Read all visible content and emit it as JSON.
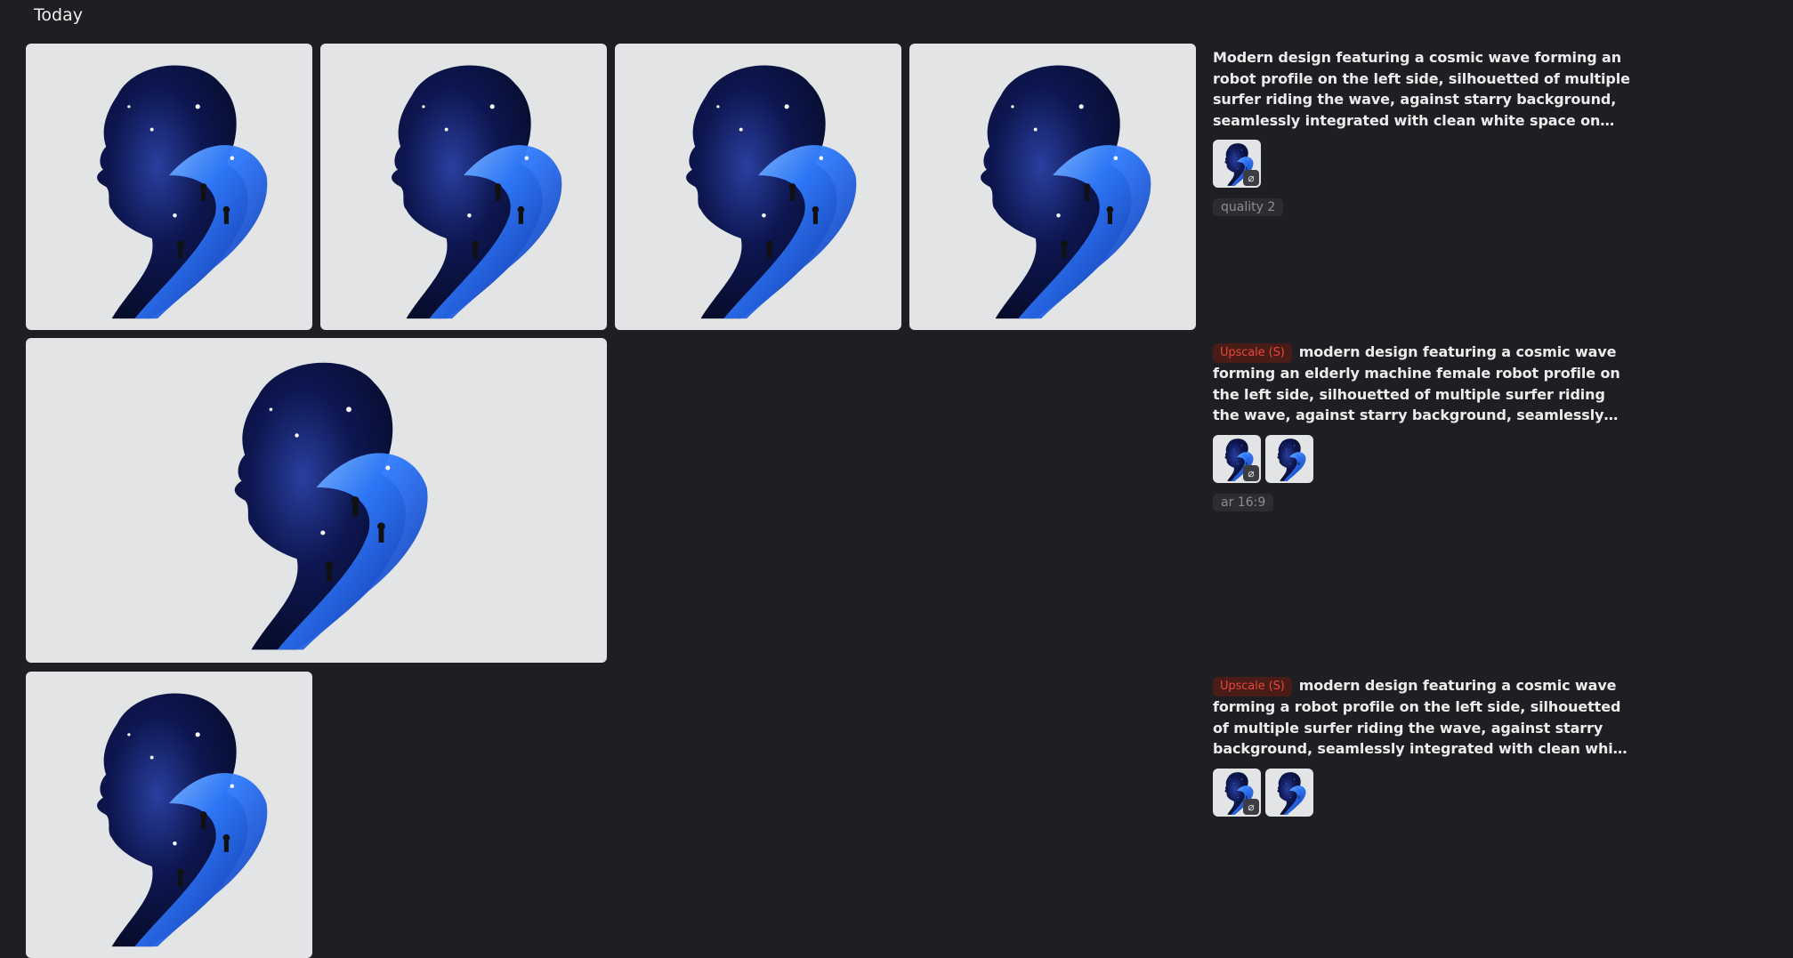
{
  "section": {
    "title": "Today"
  },
  "jobs": [
    {
      "prompt": "Modern design featuring a cosmic wave forming an robot profile on the left side, silhouetted of multiple surfer riding the wave, against starry background, seamlessly integrated with clean white space on right side for text content, professional...",
      "badge": "",
      "refs": [
        {
          "clip_icon": "paperclip-icon"
        }
      ],
      "chip": "quality 2"
    },
    {
      "prompt": "modern design featuring a cosmic wave forming an elderly machine female robot profile on the left side, silhouetted of multiple surfer riding the wave, against starry background, seamlessly integrated with clean white space on...",
      "badge": "Upscale (S)",
      "refs": [
        {
          "clip_icon": "paperclip-icon"
        },
        {
          "clip_icon": ""
        }
      ],
      "chip": "ar 16:9"
    },
    {
      "prompt": "modern design featuring a cosmic wave forming a robot profile on the left side, silhouetted of multiple surfer riding the wave, against starry background, seamlessly integrated with clean white space on right side for text...",
      "badge": "Upscale (S)",
      "refs": [
        {
          "clip_icon": "paperclip-icon"
        },
        {
          "clip_icon": ""
        }
      ],
      "chip": ""
    }
  ],
  "colors": {
    "background": "#1e1f22",
    "badge_text": "#e5483a",
    "badge_bg": "#4a1c18",
    "image_bg": "#e3e4e6"
  }
}
